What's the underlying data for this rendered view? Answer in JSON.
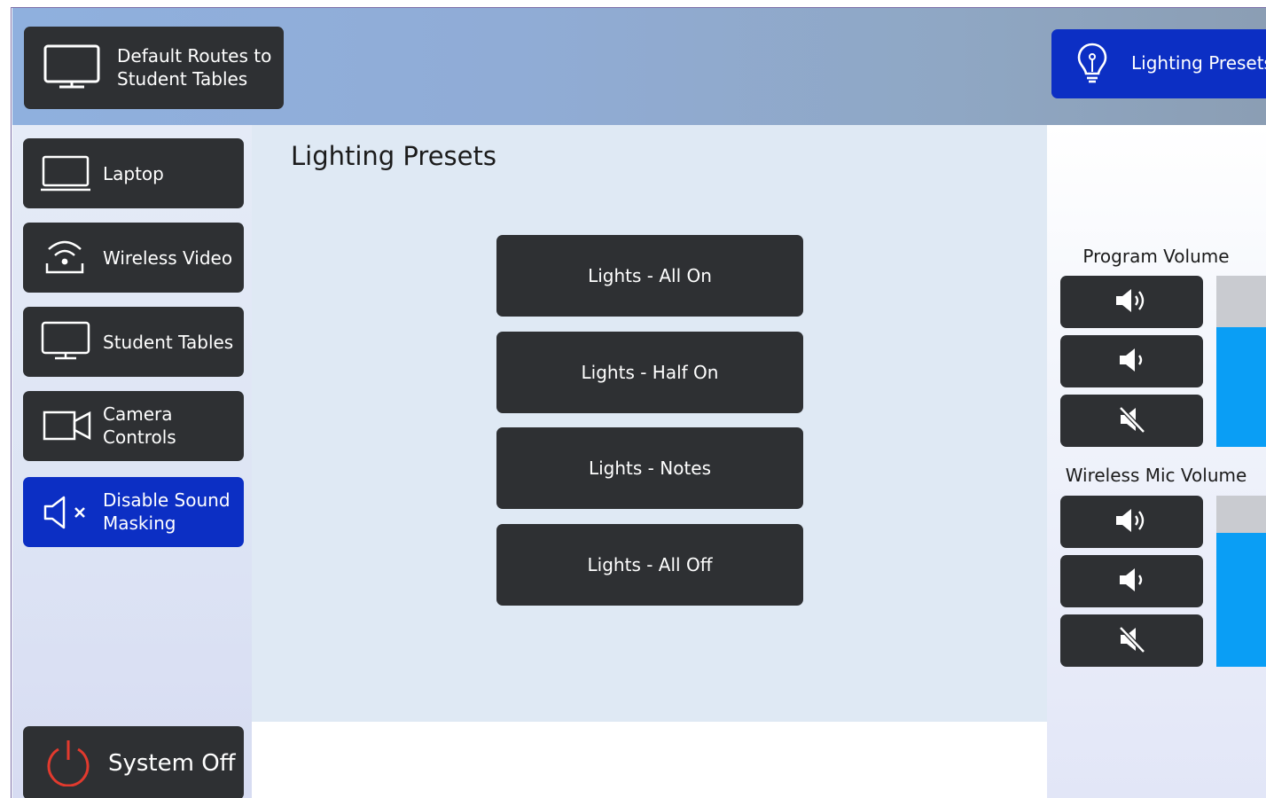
{
  "header": {
    "default_routes": {
      "line1": "Default Routes to",
      "line2": "Student Tables",
      "icon": "monitor-icon"
    },
    "lighting_tab": {
      "label": "Lighting Presets",
      "icon": "lightbulb-icon"
    }
  },
  "sidebar": {
    "items": [
      {
        "line1": "Laptop",
        "line2": "",
        "icon": "laptop-icon"
      },
      {
        "line1": "Wireless Video",
        "line2": "",
        "icon": "wireless-video-icon"
      },
      {
        "line1": "Student Tables",
        "line2": "",
        "icon": "monitor-icon"
      },
      {
        "line1": "Camera",
        "line2": "Controls",
        "icon": "camera-icon"
      },
      {
        "line1": "Disable Sound",
        "line2": "Masking",
        "icon": "speaker-mute-icon",
        "active": true
      }
    ],
    "system_off": {
      "label": "System Off",
      "icon": "power-icon"
    }
  },
  "main": {
    "title": "Lighting Presets",
    "presets": [
      "Lights - All On",
      "Lights - Half On",
      "Lights - Notes",
      "Lights - All Off"
    ]
  },
  "volume": {
    "program": {
      "title": "Program Volume",
      "level": 0.7
    },
    "mic": {
      "title": "Wireless Mic Volume",
      "level": 0.78
    }
  },
  "colors": {
    "button_dark": "#2e3033",
    "accent_blue": "#0c2fc4",
    "volume_fill": "#0a9ef5",
    "power_red": "#e23a2e"
  }
}
